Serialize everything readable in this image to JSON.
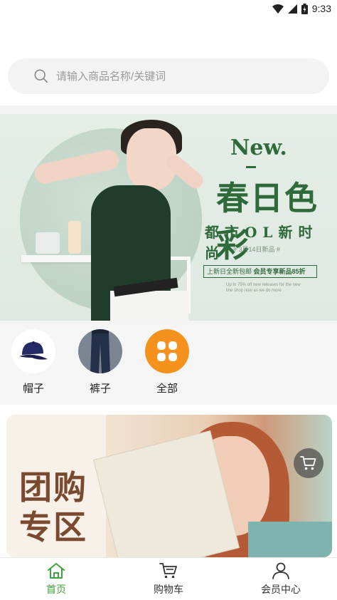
{
  "status_bar": {
    "time": "9:33",
    "icons": [
      "wifi-icon",
      "signal-icon",
      "battery-icon"
    ]
  },
  "search": {
    "placeholder": "请输入商品名称/关键词",
    "value": ""
  },
  "banner": {
    "new_label": "New.",
    "title": "春日色彩",
    "subtitle": "都市OL新时尚",
    "date_line": "# 3月14日新品 #",
    "promo_prefix": "上新日全新包邮",
    "promo_highlight": "会员专享新品85折",
    "fine_print": "Up to 75% off new releases for the new line shop now as we do more"
  },
  "categories": [
    {
      "label": "帽子",
      "icon": "cap-icon"
    },
    {
      "label": "裤子",
      "icon": "pants-icon"
    },
    {
      "label": "全部",
      "icon": "grid-icon"
    }
  ],
  "group_buy": {
    "title_line1": "团购",
    "title_line2": "专区"
  },
  "tabbar": {
    "items": [
      {
        "label": "首页",
        "icon": "home-icon",
        "active": true
      },
      {
        "label": "购物车",
        "icon": "cart-icon",
        "active": false
      },
      {
        "label": "会员中心",
        "icon": "user-icon",
        "active": false
      }
    ]
  },
  "colors": {
    "accent": "#3ea33e",
    "banner_green": "#2f6a3b",
    "category_all": "#f5921e"
  }
}
